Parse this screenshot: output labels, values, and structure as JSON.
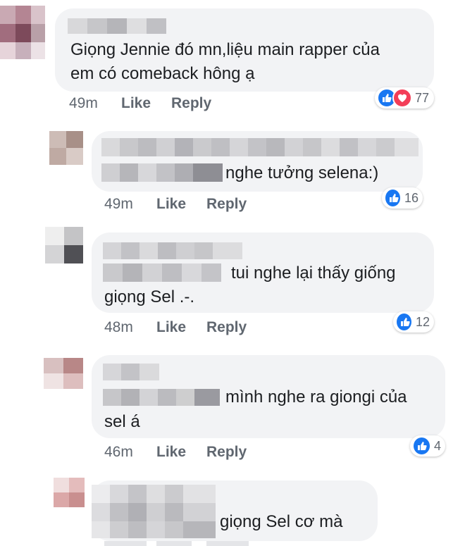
{
  "comments": [
    {
      "text_lines": [
        "Giọng Jennie đó mn,liệu main rapper của",
        "em có comeback hông ạ"
      ],
      "time": "49m",
      "like_label": "Like",
      "reply_label": "Reply",
      "reactions": [
        "like-icon",
        "love-icon"
      ],
      "reaction_count": "77"
    },
    {
      "text_lines": [
        "nghe tưởng selena:)"
      ],
      "time": "49m",
      "like_label": "Like",
      "reply_label": "Reply",
      "reactions": [
        "like-icon"
      ],
      "reaction_count": "16"
    },
    {
      "text_lines": [
        "tui nghe lại thấy giống",
        "giọng Sel .-."
      ],
      "time": "48m",
      "like_label": "Like",
      "reply_label": "Reply",
      "reactions": [
        "like-icon"
      ],
      "reaction_count": "12"
    },
    {
      "text_lines": [
        "mình nghe ra giongi của",
        "sel á"
      ],
      "time": "46m",
      "like_label": "Like",
      "reply_label": "Reply",
      "reactions": [
        "like-icon"
      ],
      "reaction_count": "4"
    },
    {
      "text_lines": [
        "giọng Sel cơ mà"
      ],
      "time": "",
      "like_label": "",
      "reply_label": "",
      "reactions": [],
      "reaction_count": ""
    }
  ],
  "colors": {
    "bubble": "#f2f3f5",
    "like_blue": "#1877f2",
    "love_red": "#f33e58",
    "meta_gray": "#606770"
  }
}
